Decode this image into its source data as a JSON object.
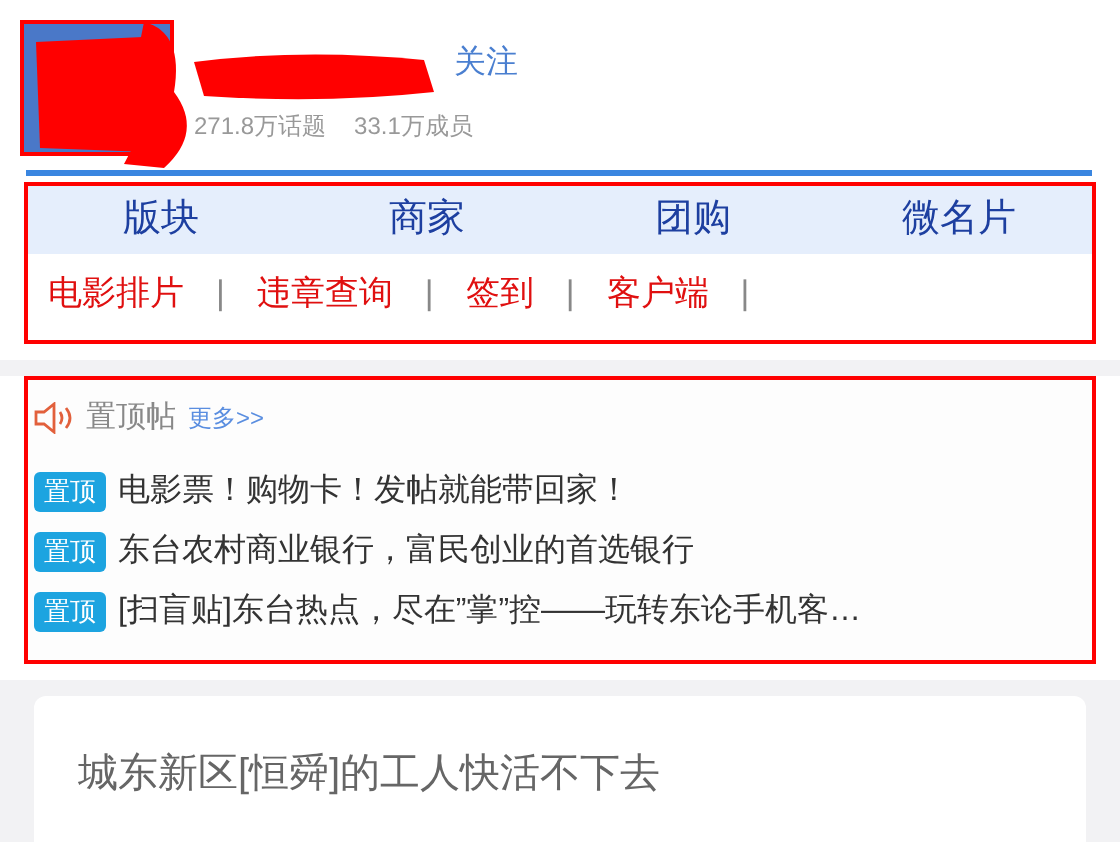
{
  "header": {
    "follow": "关注",
    "stats": [
      "271.8万话题",
      "33.1万成员"
    ]
  },
  "nav": {
    "tabs": [
      {
        "label": "版块"
      },
      {
        "label": "商家"
      },
      {
        "label": "团购"
      },
      {
        "label": "微名片"
      }
    ],
    "links": [
      {
        "label": "电影排片",
        "separator": "|"
      },
      {
        "label": "违章查询",
        "separator": "|"
      },
      {
        "label": "签到",
        "separator": "|"
      },
      {
        "label": "客户端",
        "separator": "|"
      }
    ]
  },
  "pinned": {
    "title": "置顶帖",
    "more": "更多>>",
    "posts": [
      {
        "badge": "置顶",
        "title": "电影票！购物卡！发帖就能带回家！"
      },
      {
        "badge": "置顶",
        "title": "东台农村商业银行，富民创业的首选银行"
      },
      {
        "badge": "置顶",
        "title": "[扫盲贴]东台热点，尽在”掌”控——玩转东论手机客…"
      }
    ]
  },
  "post_card": {
    "title": "城东新区[恒舜]的工人快活不下去"
  }
}
